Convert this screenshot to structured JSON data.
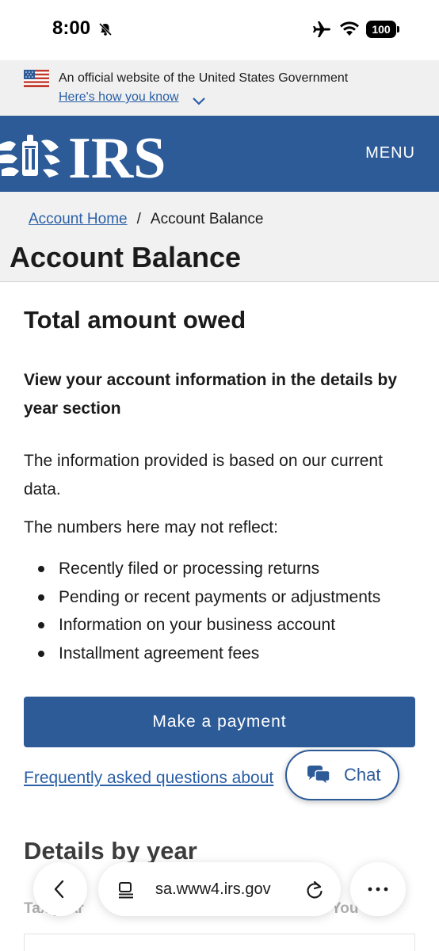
{
  "status_bar": {
    "time": "8:00",
    "battery": "100",
    "icons": [
      "bell-slash-icon",
      "airplane-icon",
      "wifi-icon",
      "battery-icon"
    ]
  },
  "gov_banner": {
    "text": "An official website of the United States Government",
    "link": "Here's how you know"
  },
  "header": {
    "logo_text": "IRS",
    "menu_label": "MENU",
    "brand_color": "#2d5b98"
  },
  "breadcrumb": {
    "home": "Account Home",
    "separator": "/",
    "current": "Account Balance"
  },
  "page_title": "Account Balance",
  "main": {
    "section_title": "Total amount owed",
    "intro_bold": "View your account information in the details by year section",
    "info_p1": "The information provided is based on our current data.",
    "info_p2": "The numbers here may not reflect:",
    "bullets": [
      "Recently filed or processing returns",
      "Pending or recent payments or adjustments",
      "Information on your business account",
      "Installment agreement fees"
    ],
    "pay_button": "Make a payment",
    "faq_link": "Frequently asked questions about",
    "chat_label": "Chat",
    "details_title": "Details by year",
    "col_left": "Tax year",
    "col_right": "You owe"
  },
  "browser": {
    "url": "sa.www4.irs.gov"
  }
}
